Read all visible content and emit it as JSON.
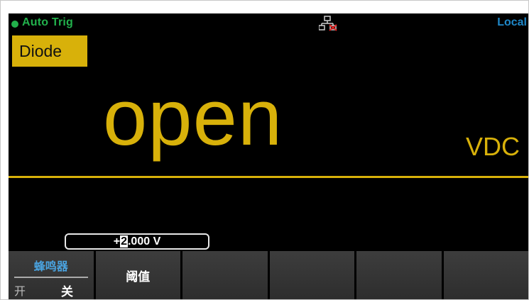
{
  "status_bar": {
    "trigger_mode": "Auto Trig",
    "indicator_color": "#22b14c",
    "network_icon": "network-disconnected-icon",
    "control_mode": "Local"
  },
  "measurement": {
    "function": "Diode",
    "reading": "open",
    "unit": "VDC"
  },
  "threshold_input": {
    "prefix": "+",
    "cursor_digit": "2",
    "suffix": ".000 V"
  },
  "softkeys": {
    "beeper": {
      "title": "蜂鸣器",
      "option_on": "开",
      "option_off": "关"
    },
    "threshold": {
      "label": "阈值"
    }
  },
  "colors": {
    "accent": "#d8b10a",
    "status_green": "#22b14c",
    "local_blue": "#1f88c9",
    "background": "#000000"
  }
}
